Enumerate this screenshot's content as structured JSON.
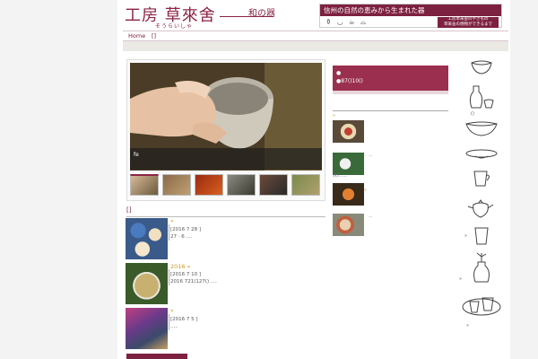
{
  "header": {
    "logo": "工房 草來舍",
    "logo_sub": "和の器",
    "logo_kana": "そうらいしゃ",
    "banner_title": "信州の自然の恵みから生まれた器",
    "banner_link1": "工房草來舍のやきもの",
    "banner_link2": "草來舍の焼物ができるまで"
  },
  "nav": {
    "home": "Home",
    "item1": "[]"
  },
  "slider": {
    "caption": "fe",
    "thumb_count": 6
  },
  "news": {
    "heading": "[]",
    "items": [
      {
        "bullet": "»",
        "title": "",
        "date": "[2016 7 28 ]",
        "text": "27 · 6 ...."
      },
      {
        "bullet": "",
        "title": "2016 »",
        "date": "[2016 7 10 ]",
        "text": "2016 721(127() ...."
      },
      {
        "bullet": "»",
        "title": "",
        "date": "[2016 7 5 ]",
        "text": "....."
      }
    ]
  },
  "sidebar_mid": {
    "shop_line1": "●",
    "shop_line2": "●87()10()",
    "shop_dot": ".",
    "arrow": "»",
    "items": [
      {
        "dots": "...",
        "arrow": ""
      },
      {
        "dots": "...",
        "arrow": ""
      },
      {
        "dots": "...",
        "arrow": "»"
      },
      {
        "dots": "...",
        "arrow": ""
      }
    ],
    "label": "(k)......"
  },
  "icon_column": {
    "label_1": "()",
    "label_2": "»",
    "label_3": "»",
    "label_4": "»"
  },
  "colors": {
    "brand": "#8b2346",
    "accent_gold": "#c89a20"
  }
}
